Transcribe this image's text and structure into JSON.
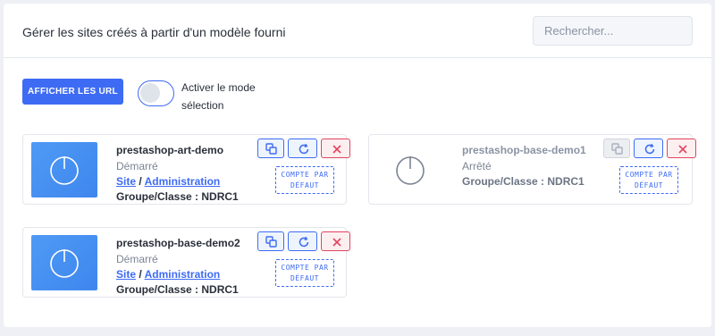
{
  "header": {
    "title": "Gérer les sites créés à partir d'un modèle fourni",
    "search_placeholder": "Rechercher..."
  },
  "toolbar": {
    "show_url_label": "AFFICHER LES URL",
    "selection_mode_label": "Activer le mode sélection",
    "selection_mode_on": false
  },
  "sites": [
    {
      "name": "prestashop-art-demo",
      "status": "Démarré",
      "running": true,
      "site_link": "Site",
      "separator": "/",
      "admin_link": "Administration",
      "group": "Groupe/Classe : NDRC1",
      "stamp": "COMPTE PAR DÉFAUT"
    },
    {
      "name": "prestashop-base-demo1",
      "status": "Arrêté",
      "running": false,
      "group": "Groupe/Classe : NDRC1",
      "stamp": "COMPTE PAR DÉFAUT"
    },
    {
      "name": "prestashop-base-demo2",
      "status": "Démarré",
      "running": true,
      "site_link": "Site",
      "separator": "/",
      "admin_link": "Administration",
      "group": "Groupe/Classe : NDRC1",
      "stamp": "COMPTE PAR DÉFAUT"
    }
  ],
  "icons": {
    "power": "power-icon",
    "copy": "copy-icon",
    "reload": "reload-icon",
    "delete": "close-icon"
  },
  "colors": {
    "accent": "#3e6bf4",
    "danger": "#e0455e",
    "thumb_on": "#4f9af5",
    "thumb_off": "#8a93a3"
  }
}
